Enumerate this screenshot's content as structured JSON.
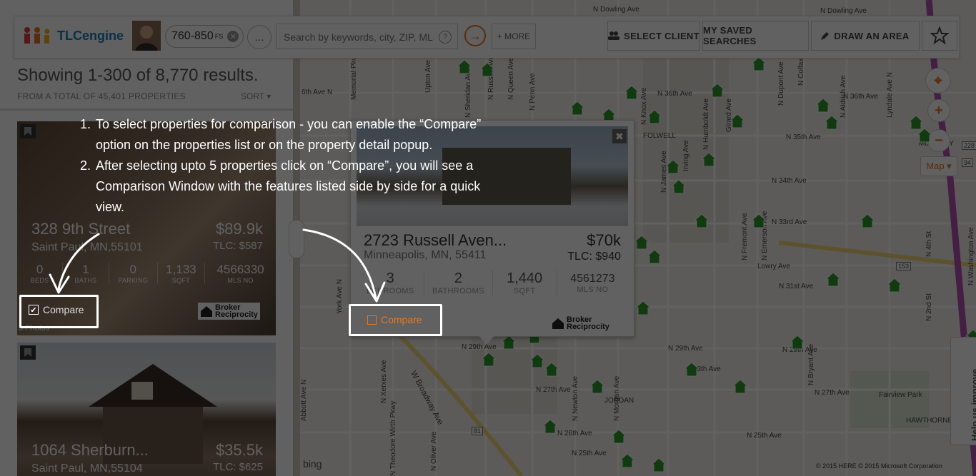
{
  "topbar": {
    "logo_text": "TLCengine",
    "price_filter": "760-850",
    "price_suffix": "FS",
    "search_placeholder": "Search by keywords, city, ZIP, MLS #",
    "more_label": "+ MORE",
    "select_client_label": "SELECT CLIENT",
    "saved_searches_label": "MY SAVED SEARCHES",
    "draw_area_label": "DRAW AN AREA"
  },
  "results": {
    "heading": "Showing 1-300 of 8,770 results.",
    "subheading": "FROM A TOTAL OF 45,401 PROPERTIES",
    "sort_label": "SORT ▾"
  },
  "listings": [
    {
      "address": "328 9th Street",
      "city": "Saint Paul, MN,55101",
      "price": "$89.9k",
      "tlc": "TLC: $587",
      "stats": [
        {
          "value": "0",
          "label": "BEDS"
        },
        {
          "value": "1",
          "label": "BATHS"
        },
        {
          "value": "0",
          "label": "PARKING"
        },
        {
          "value": "1,133",
          "label": "SQFT"
        },
        {
          "value": "4566330",
          "label": "MLS NO"
        }
      ],
      "compare_label": "Compare",
      "compare_checked": true,
      "photos_label": "5 Photos"
    },
    {
      "address": "1064 Sherburn...",
      "city": "Saint Paul, MN,55104",
      "price": "$35.5k",
      "tlc": "TLC: $625"
    }
  ],
  "popup": {
    "address": "2723 Russell Aven...",
    "city": "Minneapolis, MN, 55411",
    "price": "$70k",
    "tlc": "TLC: $940",
    "stats": [
      {
        "value": "3",
        "label": "BEDROOMS"
      },
      {
        "value": "2",
        "label": "BATHROOMS"
      },
      {
        "value": "1,440",
        "label": "SQFT"
      },
      {
        "value": "4561273",
        "label": "MLS NO"
      }
    ],
    "compare_label": "Compare",
    "compare_checked": false,
    "close_label": "✖"
  },
  "broker_badge": {
    "line1": "Broker",
    "line2": "Reciprocity"
  },
  "map": {
    "map_type_label": "Map ▾",
    "help_label": "Help us improve",
    "attribution": "© 2015 HERE    © 2015 Microsoft Corporation",
    "bing_label": "bing",
    "roads_h": [
      "N Dowling Ave",
      "N Dowling Ave",
      "N 36th Ave",
      "N 36th Ave",
      "N 35th Ave",
      "N 34th Ave",
      "N 33rd Ave",
      "Lowry Ave",
      "N 31st Ave",
      "N 29th Ave",
      "N 29th Ave",
      "N 29th Ave",
      "N 28th Ave",
      "N 27th Ave",
      "N 27th Ave",
      "N 26th Ave",
      "N 25th Ave",
      "N 25th Ave",
      "6th Ave N",
      "FOLWELL",
      "JORDAN",
      "Fairview Park",
      "HAWTHORNE",
      "McKINLEY",
      "W Broadway Ave"
    ],
    "roads_v": [
      "Upton Ave",
      "N Sheridan Ave",
      "N Russell Ave",
      "N Queen Ave",
      "N Penn Ave",
      "N Knox Ave",
      "Irving Ave",
      "N James Ave",
      "N Humboldt Ave",
      "Girard Ave",
      "N Fremont Ave",
      "N Emerson Ave",
      "N Dupont Ave",
      "N Colfax Ave",
      "N Bryant Ave",
      "N Aldrich Ave",
      "Lyndale Ave N",
      "N 4th St",
      "N 2nd St",
      "N Washington Ave",
      "York Ave N",
      "N Xerxes Ave",
      "N Theodore Wirth Pkwy",
      "N Newton Ave",
      "N Morgan Ave",
      "N Oliver Ave",
      "Abbott Ave N",
      "Memorial Pkwy"
    ],
    "highway_labels": [
      "153",
      "81",
      "228",
      "94"
    ]
  },
  "tutorial": {
    "steps": [
      "To select properties for comparison - you can enable the “Compare” option on the  properties list or on the property detail popup.",
      "After selecting upto 5 properties click on “Compare”, you will see a Comparison Window with the features  listed side by side for a quick view."
    ]
  },
  "colors": {
    "accent": "#e87722",
    "brand": "#1a7fc1",
    "pin": "#2e9a2e"
  }
}
